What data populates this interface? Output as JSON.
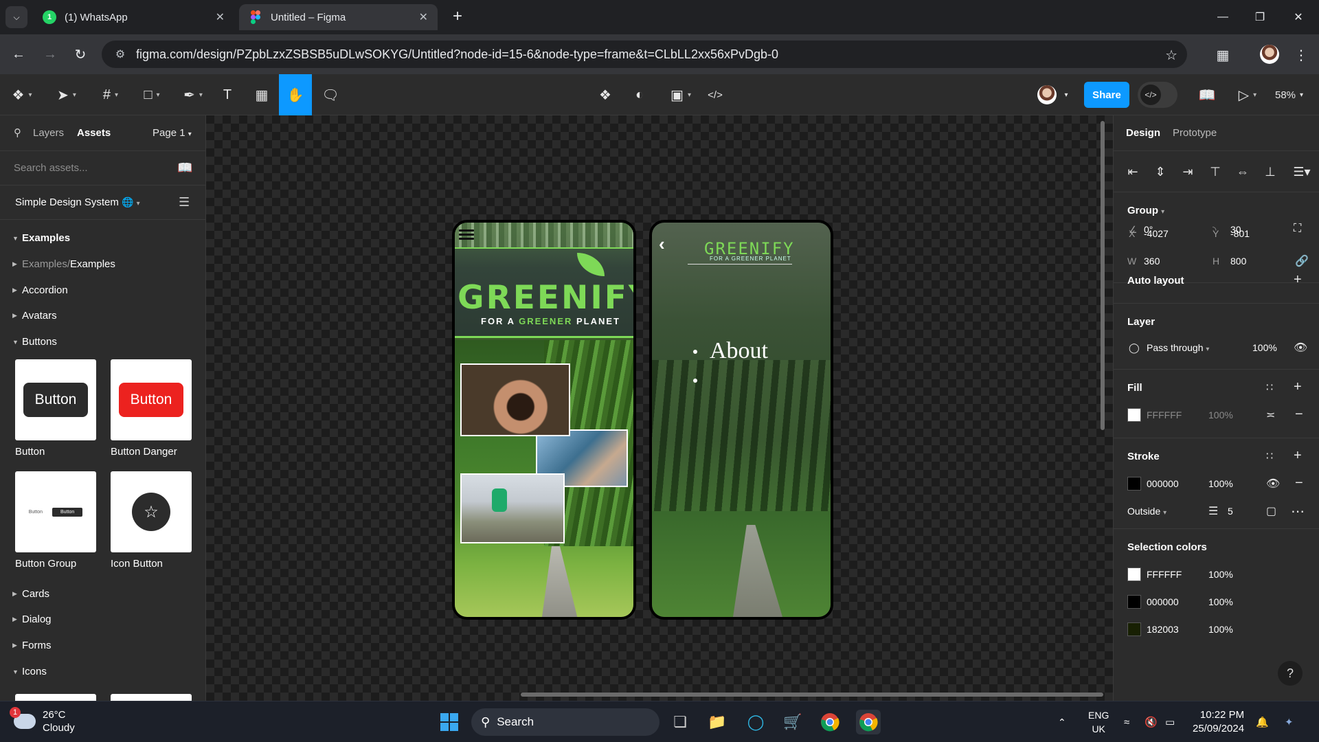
{
  "browser": {
    "tabs": [
      {
        "title": "(1) WhatsApp",
        "favicon": "whatsapp-icon",
        "badge": "1"
      },
      {
        "title": "Untitled – Figma",
        "favicon": "figma-icon"
      }
    ],
    "url": "figma.com/design/PZpbLzxZSBSB5uDLwSOKYG/Untitled?node-id=15-6&node-type=frame&t=CLbLL2xx56xPvDgb-0"
  },
  "toolbar": {
    "share_label": "Share",
    "zoom": "58%",
    "selected_tool": "hand-tool"
  },
  "left_panel": {
    "tab_layers": "Layers",
    "tab_assets": "Assets",
    "page": "Page 1",
    "search_placeholder": "Search assets...",
    "library": "Simple Design System",
    "sections": {
      "examples": "Examples",
      "examples_crumb_parent": "Examples",
      "examples_crumb_sep": " / ",
      "examples_crumb_child": "Examples",
      "accordion": "Accordion",
      "avatars": "Avatars",
      "buttons": "Buttons",
      "cards": "Cards",
      "dialog": "Dialog",
      "forms": "Forms",
      "icons": "Icons"
    },
    "components": [
      {
        "name": "Button",
        "preview_text": "Button"
      },
      {
        "name": "Button Danger",
        "preview_text": "Button"
      },
      {
        "name": "Button Group",
        "preview_text": "Button"
      },
      {
        "name": "Icon Button"
      }
    ]
  },
  "canvas": {
    "screen1": {
      "title": "GREENIFY",
      "subtitle_pre": "FOR A ",
      "subtitle_accent": "GREENER",
      "subtitle_post": " PLANET"
    },
    "screen2": {
      "logo": "GREENIFY",
      "logo_sub": "FOR A GREENER PLANET",
      "menu_item": "About"
    }
  },
  "right_panel": {
    "tab_design": "Design",
    "tab_prototype": "Prototype",
    "group_label": "Group",
    "x_label": "X",
    "x": "-4027",
    "y_label": "Y",
    "y": "-801",
    "w_label": "W",
    "w": "360",
    "h_label": "H",
    "h": "800",
    "rotation": "0°",
    "radius": "30",
    "auto_layout": "Auto layout",
    "layer": "Layer",
    "blend": "Pass through",
    "layer_opacity": "100%",
    "fill": "Fill",
    "fill_color": "FFFFFF",
    "fill_opacity": "100%",
    "stroke": "Stroke",
    "stroke_color": "000000",
    "stroke_opacity": "100%",
    "stroke_position": "Outside",
    "stroke_weight": "5",
    "selection_colors": "Selection colors",
    "colors": [
      {
        "hex": "FFFFFF",
        "opacity": "100%",
        "swatch": "#ffffff"
      },
      {
        "hex": "000000",
        "opacity": "100%",
        "swatch": "#000000"
      },
      {
        "hex": "182003",
        "opacity": "100%",
        "swatch": "#182003"
      }
    ]
  },
  "taskbar": {
    "temp": "26°C",
    "weather": "Cloudy",
    "weather_badge": "1",
    "search": "Search",
    "lang1": "ENG",
    "lang2": "UK",
    "time": "10:22 PM",
    "date": "25/09/2024"
  },
  "colors": {
    "accent": "#0d99ff",
    "brand_green": "#7ed957",
    "danger": "#ec221f"
  }
}
